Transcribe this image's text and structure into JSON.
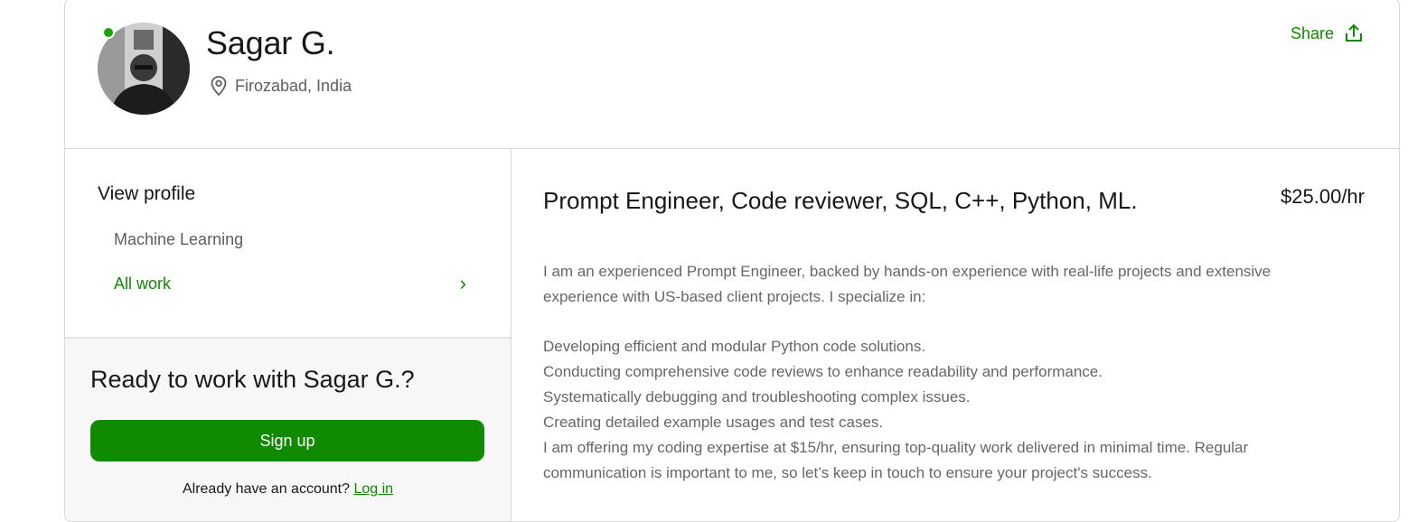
{
  "profile": {
    "name": "Sagar G.",
    "location": "Firozabad, India",
    "share_label": "Share"
  },
  "sidebar": {
    "view_profile": "View profile",
    "skill": "Machine Learning",
    "all_work": "All work",
    "chevron": "›"
  },
  "cta": {
    "title": "Ready to work with Sagar G.?",
    "signup_label": "Sign up",
    "account_prompt": "Already have an account?",
    "login_label": "Log in"
  },
  "main": {
    "title": "Prompt Engineer, Code reviewer, SQL, C++, Python, ML.",
    "rate": "$25.00/hr",
    "description": [
      "I am an experienced Prompt Engineer, backed by hands-on experience with real-life projects and extensive experience with US-based client projects. I specialize in:",
      "",
      "Developing efficient and modular Python code solutions.",
      "Conducting comprehensive code reviews to enhance readability and performance.",
      "Systematically debugging and troubleshooting complex issues.",
      "Creating detailed example usages and test cases.",
      "I am offering my coding expertise at $15/hr, ensuring top-quality work delivered in minimal time. Regular communication is important to me, so let’s keep in touch to ensure your project's success."
    ]
  },
  "colors": {
    "accent": "#108a00",
    "online": "#14a800"
  },
  "icons": [
    "location-pin-icon",
    "share-icon",
    "chevron-right-icon"
  ]
}
